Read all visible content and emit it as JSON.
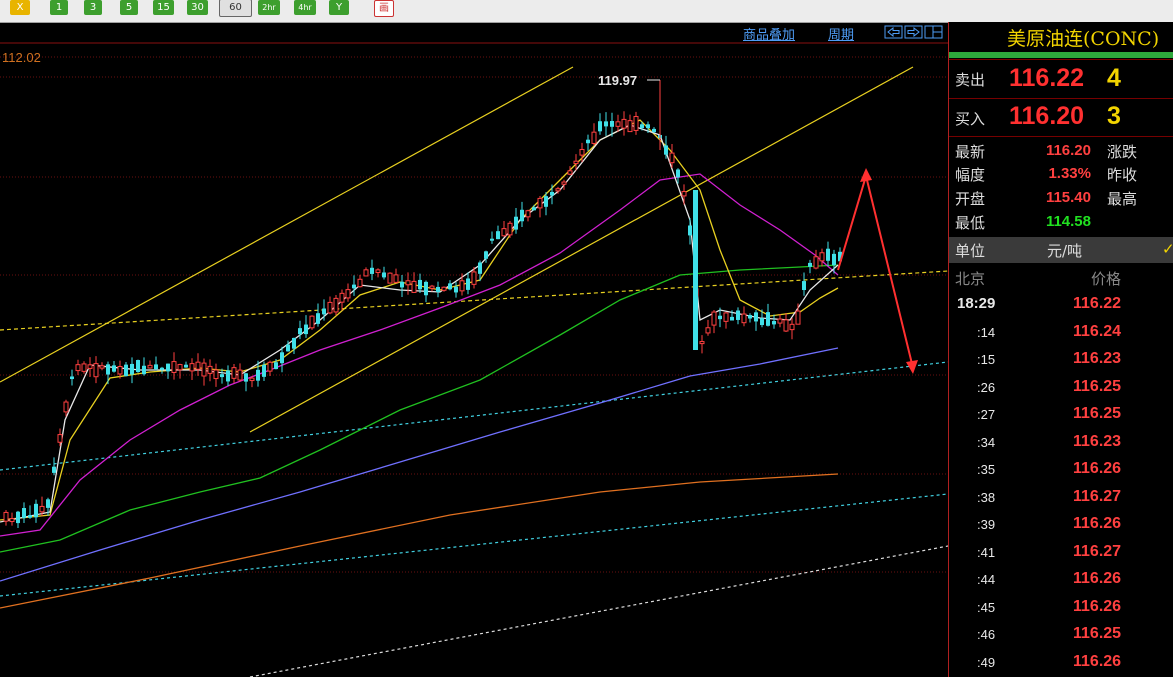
{
  "toolbar": {
    "buttons": [
      "X",
      "1",
      "3",
      "5",
      "15",
      "30",
      "60",
      "2hr",
      "4hr",
      "Y",
      "画"
    ],
    "active": "60"
  },
  "chart_header": {
    "overlay_label": "商品叠加",
    "period_label": "周期"
  },
  "price_axis": {
    "top_label": "112.02",
    "high_annotation": "119.97"
  },
  "chart_data": {
    "type": "candlestick",
    "title": "",
    "high_marker": 119.97,
    "series": [
      {
        "name": "",
        "color": "#e8e8e8",
        "type": "moving-average"
      },
      {
        "name": "",
        "color": "#e8d020",
        "type": "moving-average"
      },
      {
        "name": "",
        "color": "#d020d0",
        "type": "moving-average"
      },
      {
        "name": "",
        "color": "#20c020",
        "type": "moving-average"
      },
      {
        "name": "",
        "color": "#7070ff",
        "type": "moving-average"
      },
      {
        "name": "",
        "color": "#e07020",
        "type": "moving-average"
      }
    ]
  },
  "panel": {
    "title": "美原油连(CONC)",
    "sell_label": "卖出",
    "sell_price": "116.22",
    "sell_vol": "4",
    "buy_label": "买入",
    "buy_price": "116.20",
    "buy_vol": "3",
    "stats": [
      {
        "label": "最新",
        "value": "116.20",
        "label2": "涨跌",
        "color": "#ff4040"
      },
      {
        "label": "幅度",
        "value": "1.33%",
        "label2": "昨收",
        "color": "#ff4040"
      },
      {
        "label": "开盘",
        "value": "115.40",
        "label2": "最高",
        "color": "#ff4040"
      },
      {
        "label": "最低",
        "value": "114.58",
        "label2": "",
        "color": "#20e020"
      }
    ],
    "unit_label": "单位",
    "unit_value": "元/吨",
    "col_time": "北京",
    "col_price": "价格",
    "ticks": [
      {
        "time": "18:29",
        "price": "116.22"
      },
      {
        "time": ":14",
        "price": "116.24"
      },
      {
        "time": ":15",
        "price": "116.23"
      },
      {
        "time": ":26",
        "price": "116.25"
      },
      {
        "time": ":27",
        "price": "116.25"
      },
      {
        "time": ":34",
        "price": "116.23"
      },
      {
        "time": ":35",
        "price": "116.26"
      },
      {
        "time": ":38",
        "price": "116.27"
      },
      {
        "time": ":39",
        "price": "116.26"
      },
      {
        "time": ":41",
        "price": "116.27"
      },
      {
        "time": ":44",
        "price": "116.26"
      },
      {
        "time": ":45",
        "price": "116.26"
      },
      {
        "time": ":46",
        "price": "116.25"
      },
      {
        "time": ":49",
        "price": "116.26"
      }
    ]
  }
}
